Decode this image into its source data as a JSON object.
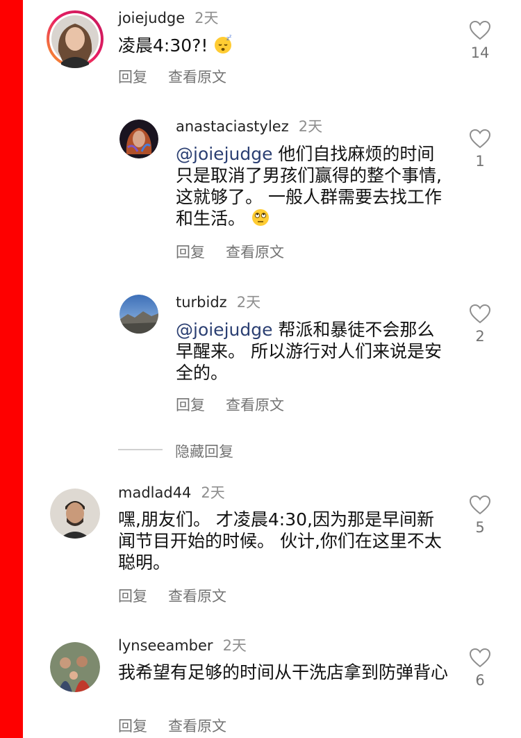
{
  "actions": {
    "reply": "回复",
    "translate": "查看原文"
  },
  "hide_replies": "隐藏回复",
  "comments": [
    {
      "username": "joiejudge",
      "time": "2天",
      "text": "凌晨4:30?! ",
      "emoji": "sleeping-face",
      "likes": "14"
    },
    {
      "username": "anastaciastylez",
      "time": "2天",
      "mention": "@joiejudge",
      "text": " 他们自找麻烦的时间只是取消了男孩们赢得的整个事情,这就够了。 一般人群需要去找工作和生活。",
      "emoji": "eye-roll-face",
      "likes": "1"
    },
    {
      "username": "turbidz",
      "time": "2天",
      "mention": "@joiejudge",
      "text": " 帮派和暴徒不会那么早醒来。 所以游行对人们来说是安全的。",
      "likes": "2"
    },
    {
      "username": "madlad44",
      "time": "2天",
      "text": "嘿,朋友们。 才凌晨4:30,因为那是早间新闻节目开始的时候。 伙计,你们在这里不太聪明。",
      "likes": "5"
    },
    {
      "username": "lynseeamber",
      "time": "2天",
      "text": "我希望有足够的时间从干洗店拿到防弹背心",
      "likes": "6"
    }
  ]
}
